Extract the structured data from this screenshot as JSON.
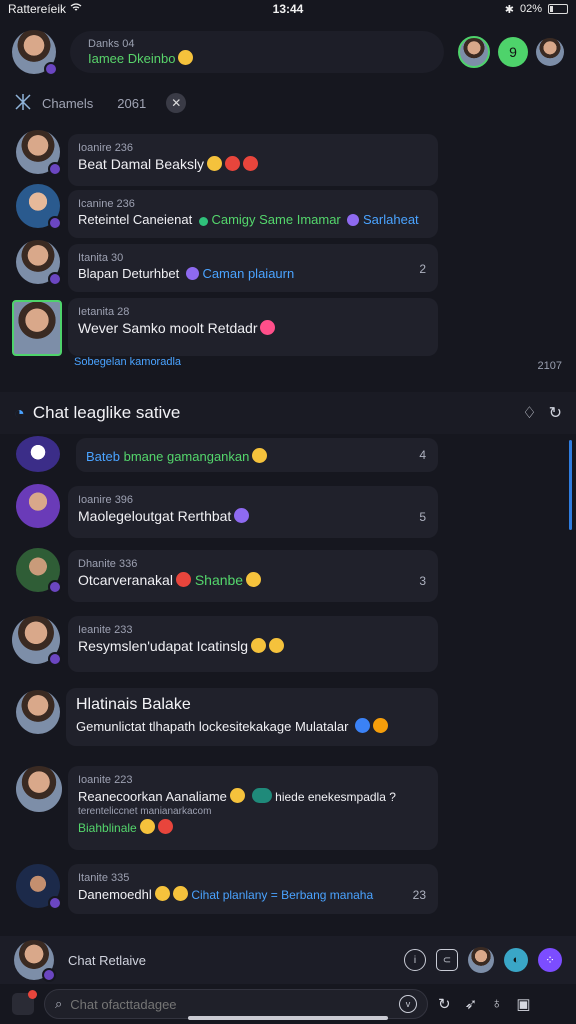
{
  "status": {
    "carrier": "Rattereíeik",
    "time": "13:44",
    "battery": "02%"
  },
  "header": {
    "contact_name": "Danks 04",
    "contact_status": "Iamee Dkeinbo",
    "action_count": "9"
  },
  "channels": {
    "label": "Chamels",
    "count": "2061"
  },
  "top_chats": [
    {
      "meta": "Ioanire 236",
      "text": "Beat Damal Beaksly"
    },
    {
      "meta": "Icanine 236",
      "text": "Reteintel Caneienat",
      "tag_green": "Camigy Same Imamar",
      "tag_blue": "Sarlaheat"
    },
    {
      "meta": "Itanita 30",
      "text": "Blapan Deturhbet",
      "tag_blue": "Caman plaiaurn",
      "count": "2"
    },
    {
      "meta": "Ietanita 28",
      "text": "Wever Samko moolt Retdadr"
    }
  ],
  "overflow_note": "Sobegelan kamoradla",
  "overflow_count": "2107",
  "section": {
    "title": "Chat leaglike sative"
  },
  "chats": [
    {
      "tag_blue": "Bateb",
      "text": "bmane gamangankan",
      "count": "4"
    },
    {
      "meta": "Ioanire 396",
      "text": "Maolegeloutgat Rerthbat",
      "count": "5"
    },
    {
      "meta": "Dhanite 336",
      "text": "Otcarveranakal",
      "tag_green": "Shanbe",
      "count": "3"
    },
    {
      "meta": "Ieanite 233",
      "text": "Resymslen'udapat Icatinslg"
    },
    {
      "title": "Hlatinais Balake",
      "text": "Gemunlictat tlhapath lockesitekakage Mulatalar"
    },
    {
      "meta": "Ioanite 223",
      "text": "Reanecoorkan Aanaliame",
      "tag_extra": "hiede enekesmpadla ?",
      "meta2": "terenteliccnet manianarkacom",
      "tag_green": "Biahblinale"
    },
    {
      "meta": "Itanite 335",
      "text": "Danemoedhl",
      "tag_blue": "Cihat planlany = Berbang manaha",
      "count": "23"
    }
  ],
  "bottom": {
    "label": "Chat Retlaive"
  },
  "composer": {
    "placeholder": "Chat ofacttadagee"
  }
}
